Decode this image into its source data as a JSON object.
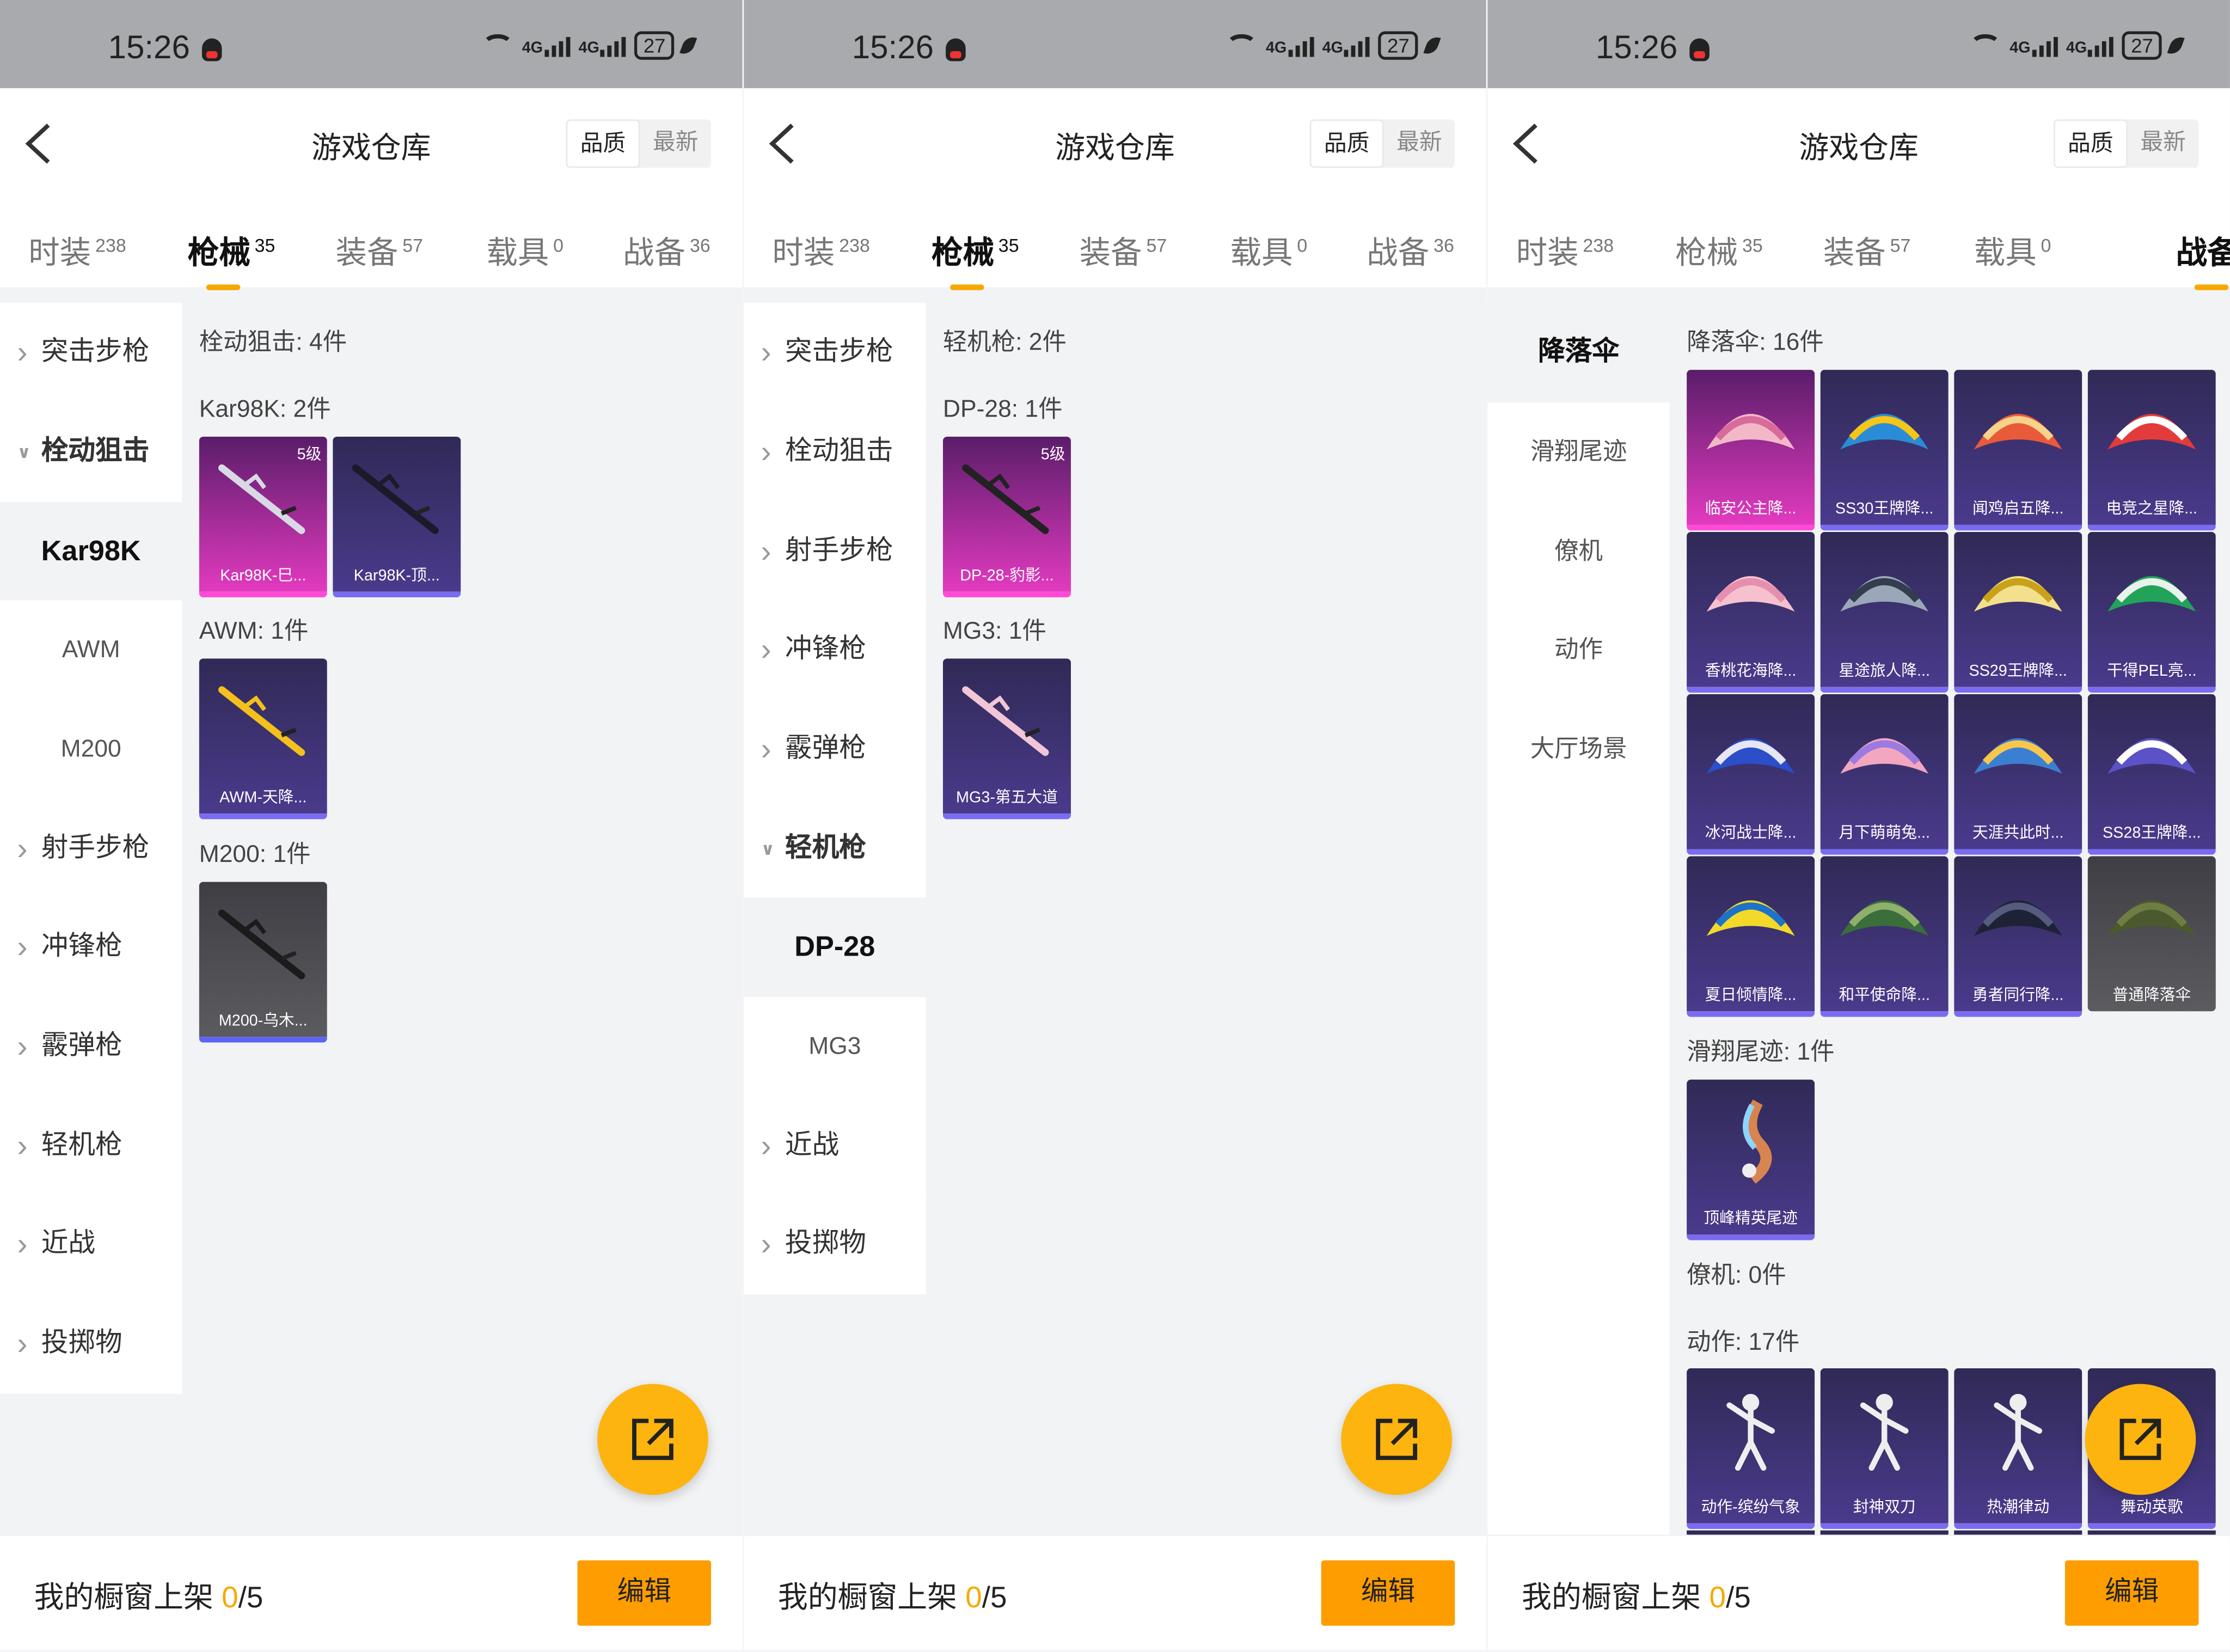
{
  "status": {
    "time": "15:26",
    "battery": "27",
    "net": "4G"
  },
  "header": {
    "title": "游戏仓库",
    "sort_quality": "品质",
    "sort_latest": "最新"
  },
  "tabs": [
    {
      "label": "时装",
      "count": "238"
    },
    {
      "label": "枪械",
      "count": "35"
    },
    {
      "label": "装备",
      "count": "57"
    },
    {
      "label": "载具",
      "count": "0"
    },
    {
      "label": "战备",
      "count": "36"
    }
  ],
  "footer": {
    "shelf_label": "我的橱窗上架",
    "shelf_count": "0",
    "shelf_total": "/5",
    "edit_label": "编辑"
  },
  "panel1": {
    "sidebar": [
      "突击步枪",
      "栓动狙击",
      "Kar98K",
      "AWM",
      "M200",
      "射手步枪",
      "冲锋枪",
      "霰弹枪",
      "轻机枪",
      "近战",
      "投掷物"
    ],
    "sections": [
      "栓动狙击: 4件",
      "Kar98K: 2件",
      "AWM: 1件",
      "M200: 1件"
    ],
    "cards": [
      {
        "name": "Kar98K-巳...",
        "level": "5级"
      },
      {
        "name": "Kar98K-顶..."
      },
      {
        "name": "AWM-天降..."
      },
      {
        "name": "M200-乌木..."
      }
    ]
  },
  "panel2": {
    "sidebar": [
      "突击步枪",
      "栓动狙击",
      "射手步枪",
      "冲锋枪",
      "霰弹枪",
      "轻机枪",
      "DP-28",
      "MG3",
      "近战",
      "投掷物"
    ],
    "sections": [
      "轻机枪: 2件",
      "DP-28: 1件",
      "MG3: 1件"
    ],
    "cards": [
      {
        "name": "DP-28-豹影...",
        "level": "5级"
      },
      {
        "name": "MG3-第五大道"
      }
    ]
  },
  "panel3": {
    "sidebar": [
      "降落伞",
      "滑翔尾迹",
      "僚机",
      "动作",
      "大厅场景"
    ],
    "sections": [
      "降落伞: 16件",
      "滑翔尾迹: 1件",
      "僚机: 0件",
      "动作: 17件"
    ],
    "parachutes": [
      "临安公主降...",
      "SS30王牌降...",
      "闻鸡启五降...",
      "电竞之星降...",
      "香桃花海降...",
      "星途旅人降...",
      "SS29王牌降...",
      "干得PEL亮...",
      "冰河战士降...",
      "月下萌萌兔...",
      "天涯共此时...",
      "SS28王牌降...",
      "夏日倾情降...",
      "和平使命降...",
      "勇者同行降...",
      "普通降落伞"
    ],
    "trails": [
      "顶峰精英尾迹"
    ],
    "emotes": [
      "动作-缤纷气象",
      "封神双刀",
      "热潮律动",
      "舞动英歌"
    ]
  }
}
